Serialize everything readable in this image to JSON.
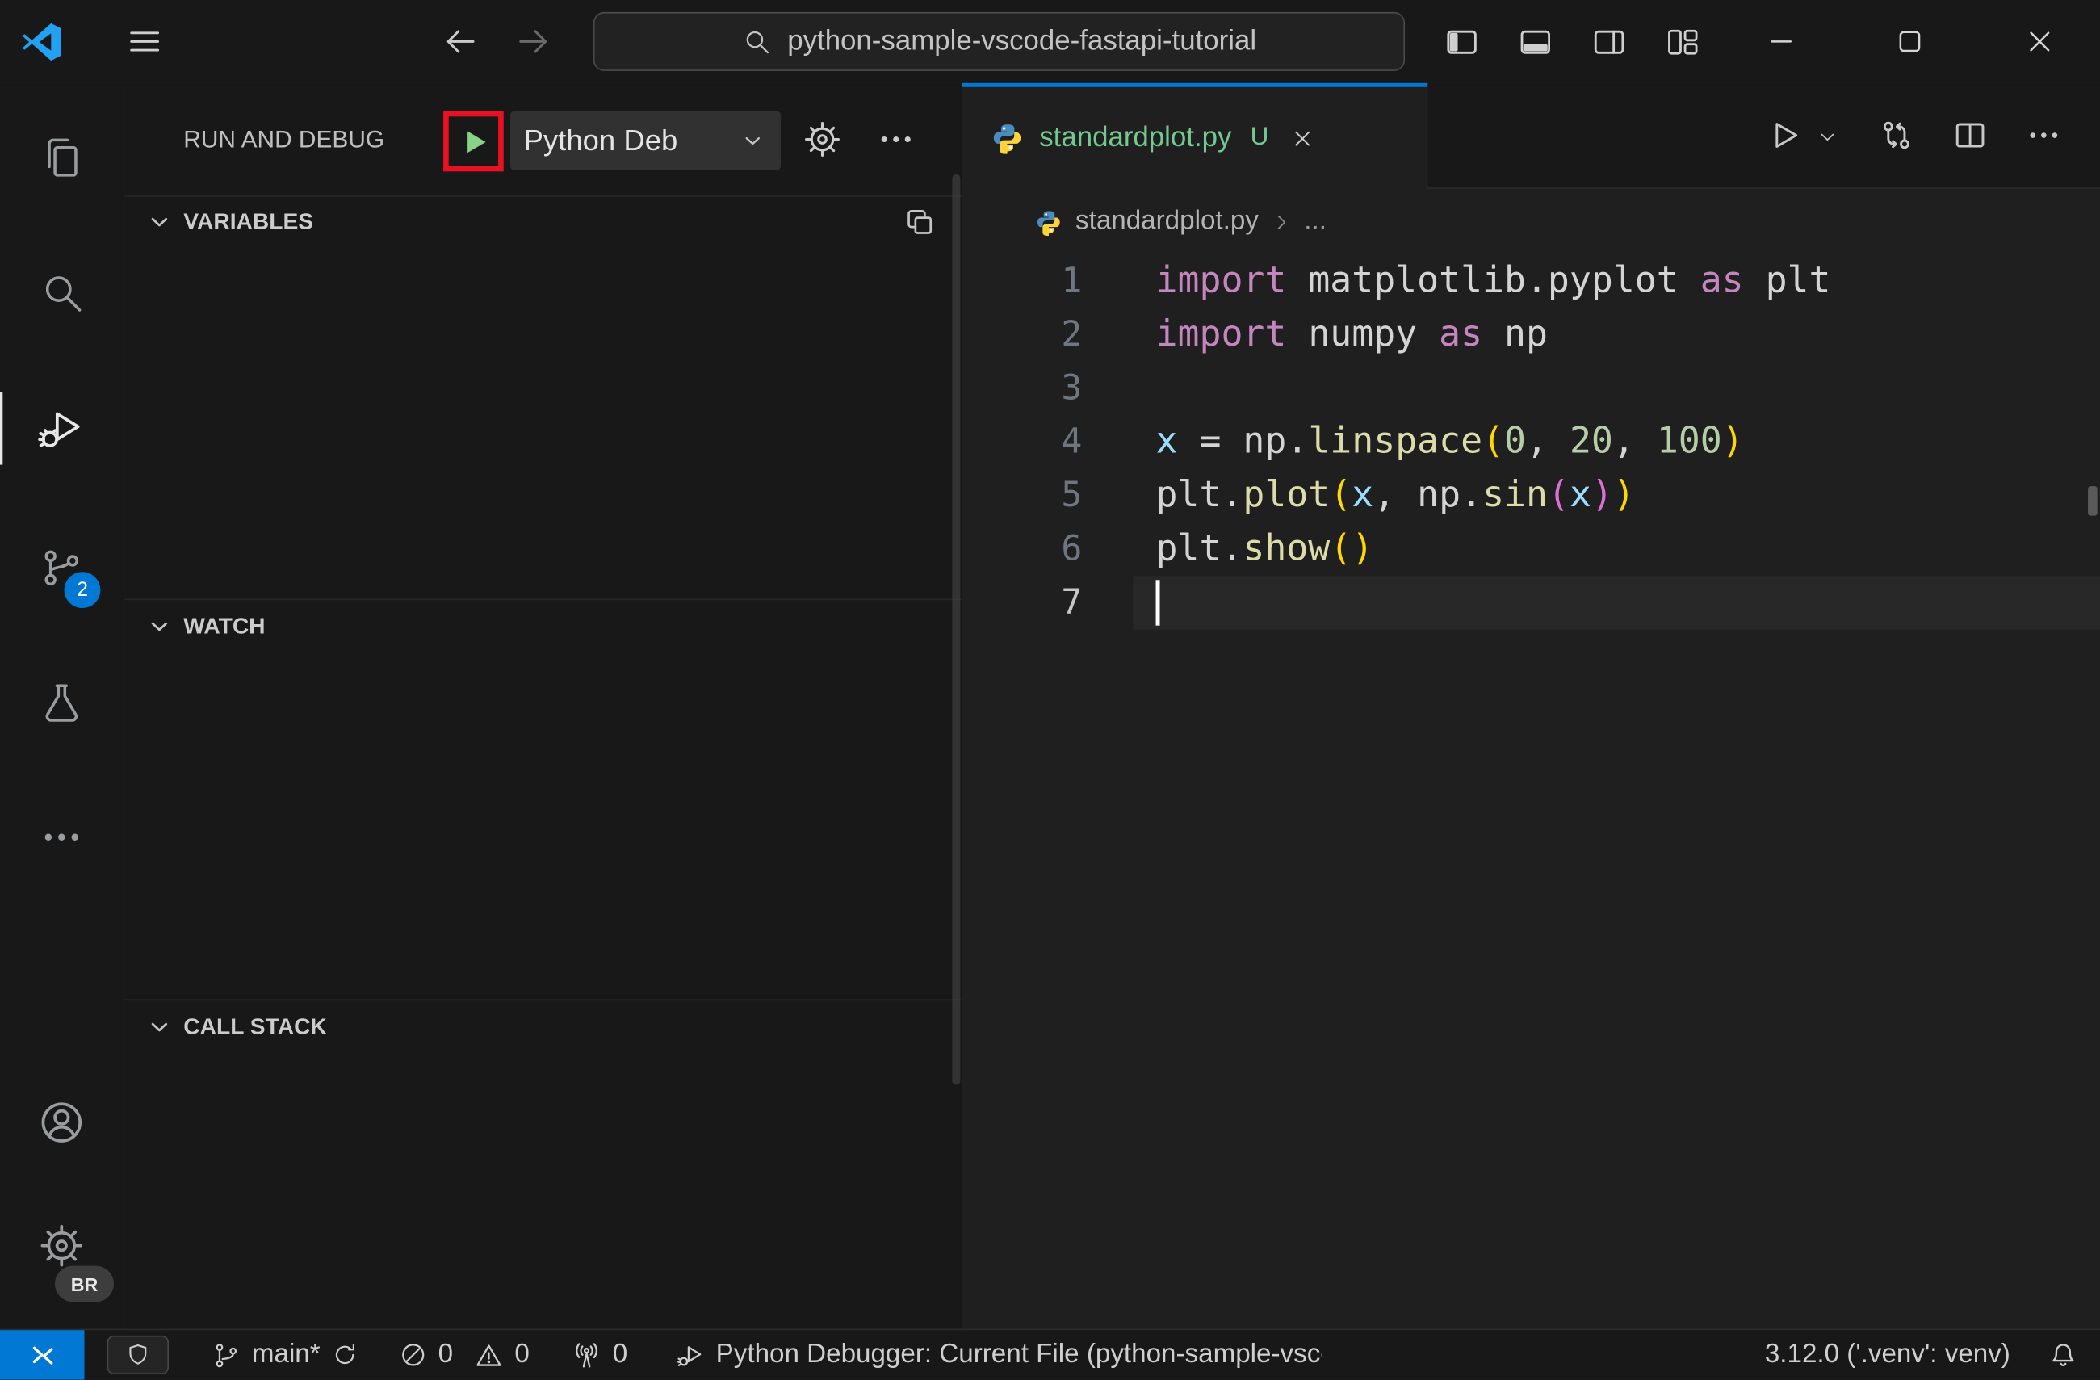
{
  "window": {
    "search_text": "python-sample-vscode-fastapi-tutorial"
  },
  "activity_bar": {
    "scm_badge": "2",
    "profile_badge": "BR"
  },
  "sidebar": {
    "title": "RUN AND DEBUG",
    "config_name": "Python Deb",
    "sections": {
      "variables": "VARIABLES",
      "watch": "WATCH",
      "call_stack": "CALL STACK"
    }
  },
  "editor": {
    "tab": {
      "name": "standardplot.py",
      "git_status": "U"
    },
    "breadcrumb": {
      "file": "standardplot.py",
      "more": "..."
    },
    "lines": [
      {
        "num": "1",
        "tokens": [
          {
            "c": "kw",
            "t": "import"
          },
          {
            "c": "pl",
            "t": " matplotlib.pyplot "
          },
          {
            "c": "kw",
            "t": "as"
          },
          {
            "c": "pl",
            "t": " plt"
          }
        ]
      },
      {
        "num": "2",
        "tokens": [
          {
            "c": "kw",
            "t": "import"
          },
          {
            "c": "pl",
            "t": " numpy "
          },
          {
            "c": "kw",
            "t": "as"
          },
          {
            "c": "pl",
            "t": " np"
          }
        ]
      },
      {
        "num": "3",
        "tokens": []
      },
      {
        "num": "4",
        "tokens": [
          {
            "c": "var",
            "t": "x"
          },
          {
            "c": "pl",
            "t": " = np."
          },
          {
            "c": "fn",
            "t": "linspace"
          },
          {
            "c": "b1",
            "t": "("
          },
          {
            "c": "num",
            "t": "0"
          },
          {
            "c": "pl",
            "t": ", "
          },
          {
            "c": "num",
            "t": "20"
          },
          {
            "c": "pl",
            "t": ", "
          },
          {
            "c": "num",
            "t": "100"
          },
          {
            "c": "b1",
            "t": ")"
          }
        ]
      },
      {
        "num": "5",
        "tokens": [
          {
            "c": "pl",
            "t": "plt."
          },
          {
            "c": "fn",
            "t": "plot"
          },
          {
            "c": "b1",
            "t": "("
          },
          {
            "c": "var",
            "t": "x"
          },
          {
            "c": "pl",
            "t": ", np."
          },
          {
            "c": "fn",
            "t": "sin"
          },
          {
            "c": "b2",
            "t": "("
          },
          {
            "c": "var",
            "t": "x"
          },
          {
            "c": "b2",
            "t": ")"
          },
          {
            "c": "b1",
            "t": ")"
          }
        ]
      },
      {
        "num": "6",
        "tokens": [
          {
            "c": "pl",
            "t": "plt."
          },
          {
            "c": "fn",
            "t": "show"
          },
          {
            "c": "b1",
            "t": "("
          },
          {
            "c": "b1",
            "t": ")"
          }
        ]
      },
      {
        "num": "7",
        "tokens": [],
        "current": true,
        "cursor": true
      }
    ]
  },
  "status_bar": {
    "branch": "main*",
    "errors": "0",
    "warnings": "0",
    "ports": "0",
    "debug_status": "Python Debugger: Current File (python-sample-vsco",
    "python_version": "3.12.0 ('.venv': venv)"
  }
}
